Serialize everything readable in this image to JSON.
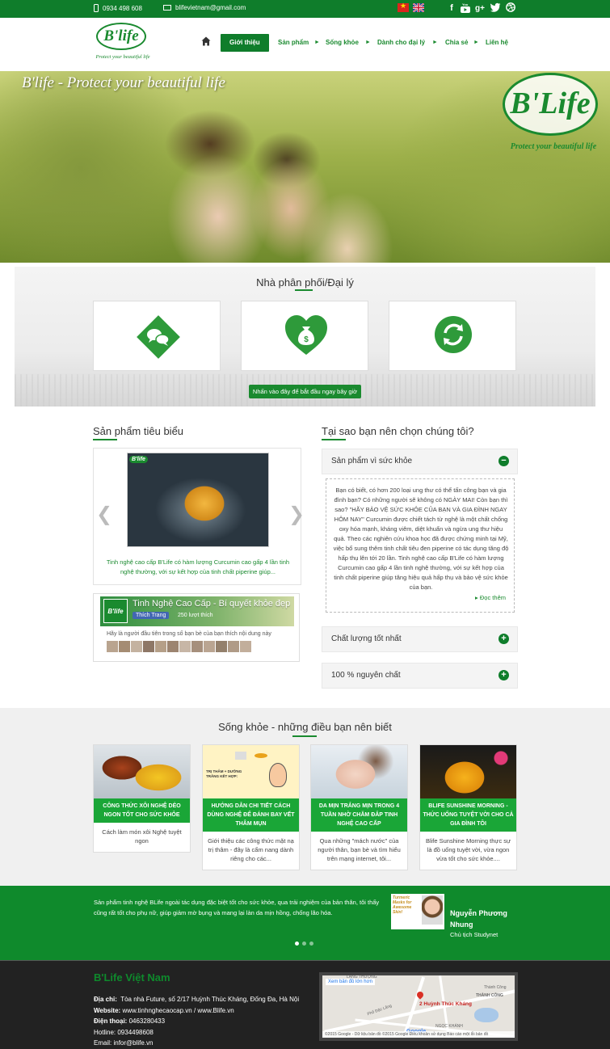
{
  "topbar": {
    "phone": "0934 498 608",
    "email": "blifevietnam@gmail.com",
    "languages": [
      "vi",
      "en"
    ],
    "social_icons": [
      "facebook-icon",
      "youtube-icon",
      "google-plus-icon",
      "twitter-icon",
      "dribbble-icon"
    ],
    "brand_color": "#0f7d2b"
  },
  "logo": {
    "text": "B'life",
    "tagline": "Protect your beautiful life"
  },
  "nav": {
    "items": [
      {
        "label": "Giới thiệu",
        "active": true
      },
      {
        "label": "Sản phẩm"
      },
      {
        "label": "Sống khỏe"
      },
      {
        "label": "Dành cho đại lý"
      },
      {
        "label": "Chia sẻ"
      },
      {
        "label": "Liên hệ"
      }
    ]
  },
  "hero": {
    "title": "B'life - Protect your beautiful life",
    "logo_text": "B'Life",
    "logo_tagline": "Protect your beautiful life"
  },
  "distributor": {
    "title": "Nhà phân phối/Đại lý",
    "cards": [
      "chat-bubbles-icon",
      "money-bag-heart-icon",
      "refresh-cycle-icon"
    ],
    "button_label": "Nhấn vào đây để bắt đầu ngay bây giờ"
  },
  "featured": {
    "title": "Sản phẩm tiêu biểu",
    "slide_logo": "B'life",
    "slide_caption": "Tinh nghệ cao cấp B'Life có hàm lượng Curcumin cao gấp 4 lần tinh nghệ thường, với sự kết hợp của tinh chất piperine giúp..."
  },
  "facebook": {
    "page_name": "Tinh Nghệ Cao Cấp - Bí quyết khỏe đẹp",
    "thumb_text": "B'life",
    "like_label": "Thích Trang",
    "like_count": "250 lượt thích",
    "friends_text": "Hãy là người đầu tiên trong số bạn bè của bạn thích nội dung này"
  },
  "why": {
    "title": "Tại sao bạn nên chọn chúng tôi?",
    "items": [
      {
        "label": "Sản phẩm vì sức khỏe",
        "toggle": "−",
        "open": true
      },
      {
        "label": "Chất lượng tốt nhất",
        "toggle": "+"
      },
      {
        "label": "100 % nguyên chất",
        "toggle": "+"
      }
    ],
    "open_text": "Bạn có biết, có hơn 200 loại ung thư có thể tấn công bạn và gia đình bạn? Có những người sẽ không có NGÀY MAI! Còn bạn thì sao? \"HÃY BẢO VỆ SỨC KHỎE CỦA BẠN VÀ GIA ĐÌNH NGAY HÔM NAY\" Curcumin được chiết tách từ nghệ là một chất chống oxy hóa mạnh, kháng viêm, diệt khuẩn và ngừa ung thư hiệu quả. Theo các nghiên cứu khoa học đã được chứng minh tại Mỹ, việc bổ sung thêm tinh chất tiêu đen piperine có tác dụng tăng độ hấp thụ lên tới 20 lần. Tinh nghệ cao cấp B'Life có hàm lượng Curcumin cao gấp 4 lần tinh nghệ thường, với sự kết hợp của tinh chất piperine giúp tăng hiệu quả hấp thụ và bảo vệ sức khỏe của bạn.",
    "read_more": "Đọc thêm"
  },
  "health": {
    "title": "Sống khỏe - những điều bạn nên biết",
    "articles": [
      {
        "title": "Công thức xôi nghệ dẻo ngon tốt cho sức khỏe",
        "desc": "Cách làm món xôi Nghệ tuyệt ngon"
      },
      {
        "title": "Hướng dẫn chi tiết cách dùng nghệ để đánh bay vết thâm mụn",
        "desc": "Giới thiệu các công thức mặt nạ trị thâm - đây là cẩm nang dành riêng cho các...",
        "img_text": "TRỊ THÂM + DƯỠNG TRẮNG KẾT HỢP:"
      },
      {
        "title": "Da mịn trắng mịn trong 4 tuần nhờ chăm đắp tinh nghệ cao cấp",
        "desc": "Qua những \"mách nước\" của người thân, bạn bè và tìm hiểu trên mạng internet, tôi..."
      },
      {
        "title": "Blife Sunshine Morning - Thức uống tuyệt vời cho cả gia đình tôi",
        "desc": "Blife Sunshine Morning thực sự là đồ uống tuyệt vời, vừa ngon vừa tốt cho sức khỏe...."
      }
    ]
  },
  "testimonial": {
    "text": "Sản phẩm tinh nghệ BLife ngoài tác dụng đặc biệt tốt cho sức khỏe, qua trải nghiệm của bản thân, tôi thấy cũng rất tốt cho phụ nữ, giúp giảm mờ bụng và mang lại làn da mịn hồng, chống lão hóa.",
    "ad_text": "Turmeric Masks for Awesome Skin!",
    "name": "Nguyễn Phương Nhung",
    "role": "Chủ tịch Studynet",
    "dots": 3,
    "active_dot": 0
  },
  "footer": {
    "title": "B'Life Việt Nam",
    "address_label": "Địa chỉ:",
    "address": "Tòa nhà Future, số 2/17 Huỳnh Thúc Kháng, Đống Đa, Hà Nội",
    "website_label": "Website:",
    "website": "www.tinhnghecaocap.vn / www.Blife.vn",
    "phone_label": "Điện thoại:",
    "phone": "0463280433",
    "hotline_label": "Hotline:",
    "hotline": "0934498608",
    "email_label": "Email:",
    "email": "infor@blife.vn"
  },
  "map": {
    "link": "Xem bản đồ lớn hơn",
    "pin_label": "2 Huỳnh Thúc Kháng",
    "labels": [
      "LÁNG THƯỢNG",
      "Phố Đặc Lãng",
      "Thành Công",
      "THÀNH CÔNG",
      "NGỌC KHÁNH"
    ],
    "footer": "©2015 Google - Dữ liệu bản đồ ©2015 Google    Điều khoản sử dụng    Báo cáo một lỗi bản đồ",
    "google": "Google"
  }
}
